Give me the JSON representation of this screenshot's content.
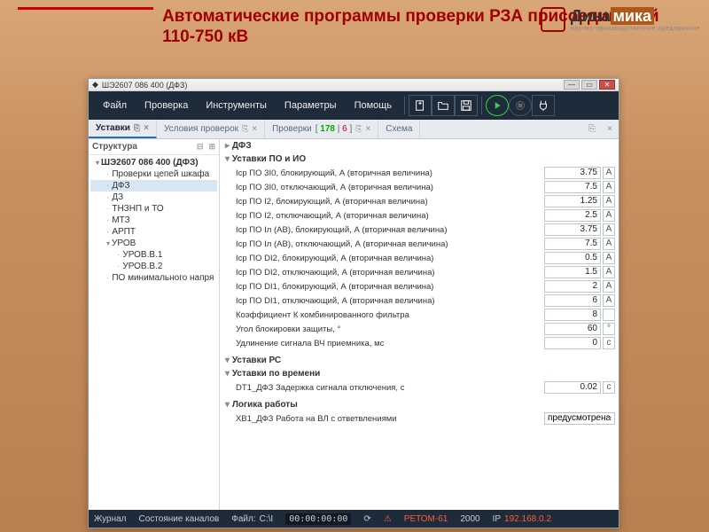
{
  "slide": {
    "title": "Автоматические программы проверки РЗА присоединений 110-750 кВ",
    "brand": "Дина",
    "brand_hl": "мика",
    "brand_sub": "научно-производственное предприятие"
  },
  "window": {
    "title": "ШЭ2607 086 400 (ДФЗ)"
  },
  "menu": {
    "file": "Файл",
    "check": "Проверка",
    "tools": "Инструменты",
    "params": "Параметры",
    "help": "Помощь"
  },
  "tabs": {
    "settings": "Уставки",
    "conditions": "Условия проверок",
    "checks": "Проверки",
    "checks_badge_a": "178",
    "checks_badge_b": "6",
    "scheme": "Схема"
  },
  "tree": {
    "header": "Структура",
    "root": "ШЭ2607 086 400 (ДФЗ)",
    "n1": "Проверки цепей шкафа",
    "n2": "ДФЗ",
    "n3": "ДЗ",
    "n4": "ТНЗНП и ТО",
    "n5": "МТЗ",
    "n6": "АРПТ",
    "n7": "УРОВ",
    "n7a": "УРОВ.В.1",
    "n7b": "УРОВ.В.2",
    "n8": "ПО минимального напря"
  },
  "form": {
    "crumb": "ДФЗ",
    "sect1": "Уставки ПО и ИО",
    "rows1": [
      {
        "label": "Icp ПО 3I0, блокирующий, А (вторичная величина)",
        "val": "3.75",
        "unit": "А"
      },
      {
        "label": "Icp ПО 3I0, отключающий, А (вторичная величина)",
        "val": "7.5",
        "unit": "А"
      },
      {
        "label": "Icp ПО I2, блокирующий, А (вторичная величина)",
        "val": "1.25",
        "unit": "А"
      },
      {
        "label": "Icp ПО I2, отключающий, А (вторичная величина)",
        "val": "2.5",
        "unit": "А"
      },
      {
        "label": "Icp ПО Iл (АВ), блокирующий, А (вторичная величина)",
        "val": "3.75",
        "unit": "А"
      },
      {
        "label": "Icp ПО Iл (АВ), отключающий, А (вторичная величина)",
        "val": "7.5",
        "unit": "А"
      },
      {
        "label": "Icp ПО DI2, блокирующий, А (вторичная величина)",
        "val": "0.5",
        "unit": "А"
      },
      {
        "label": "Icp ПО DI2, отключающий, А (вторичная величина)",
        "val": "1.5",
        "unit": "А"
      },
      {
        "label": "Icp ПО DI1, блокирующий, А (вторичная величина)",
        "val": "2",
        "unit": "А"
      },
      {
        "label": "Icp ПО DI1, отключающий, А (вторичная величина)",
        "val": "6",
        "unit": "А"
      },
      {
        "label": "Коэффициент К комбинированного фильтра",
        "val": "8",
        "unit": ""
      },
      {
        "label": "Угол блокировки защиты, °",
        "val": "60",
        "unit": "°"
      },
      {
        "label": "Удлинение сигнала ВЧ приемника, мс",
        "val": "0",
        "unit": "с"
      }
    ],
    "sect2": "Уставки РС",
    "sect3": "Уставки по времени",
    "row3": {
      "label": "DT1_ДФЗ Задержка сигнала отключения, с",
      "val": "0.02",
      "unit": "с"
    },
    "sect4": "Логика работы",
    "row4": {
      "label": "ХВ1_ДФЗ Работа на ВЛ с ответвлениями",
      "val": "предусмотрена"
    }
  },
  "status": {
    "journal": "Журнал",
    "channels": "Состояние каналов",
    "file_lbl": "Файл:",
    "file_val": "C:\\I",
    "time": "00:00:00:00",
    "retom": "РЕТОМ-61",
    "baud": "2000",
    "ip_lbl": "IP",
    "ip_val": "192.168.0.2"
  }
}
